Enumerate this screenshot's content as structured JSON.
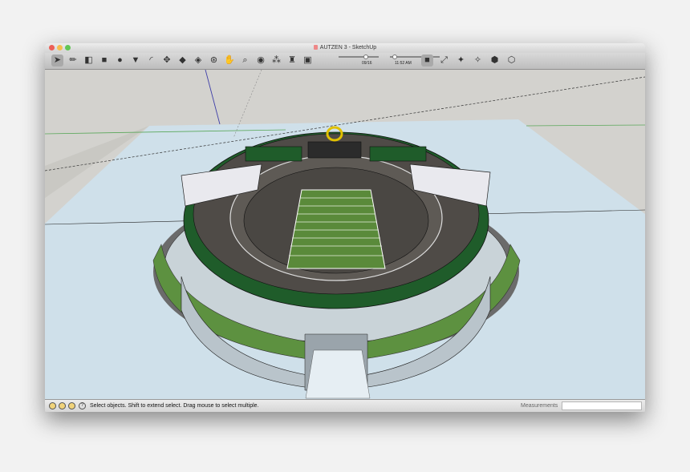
{
  "window": {
    "title": "AUTZEN 3 - SketchUp"
  },
  "toolbar": {
    "tools": [
      {
        "name": "select-tool",
        "glyph": "➤"
      },
      {
        "name": "line-tool",
        "glyph": "✏"
      },
      {
        "name": "eraser-tool",
        "glyph": "◧"
      },
      {
        "name": "rectangle-tool",
        "glyph": "■"
      },
      {
        "name": "circle-tool",
        "glyph": "●"
      },
      {
        "name": "polygon-tool",
        "glyph": "▼"
      },
      {
        "name": "arc-tool",
        "glyph": "◜"
      },
      {
        "name": "move-tool",
        "glyph": "✥"
      },
      {
        "name": "push-pull-tool",
        "glyph": "◆"
      },
      {
        "name": "paint-bucket-tool",
        "glyph": "◈"
      },
      {
        "name": "orbit-tool",
        "glyph": "⊛"
      },
      {
        "name": "pan-tool",
        "glyph": "✋"
      },
      {
        "name": "zoom-tool",
        "glyph": "⌕"
      },
      {
        "name": "look-around-tool",
        "glyph": "◉"
      },
      {
        "name": "walk-tool",
        "glyph": "⁂"
      },
      {
        "name": "position-camera-tool",
        "glyph": "♜"
      },
      {
        "name": "shadow-settings-tool",
        "glyph": "▣"
      }
    ],
    "view_tools": [
      {
        "name": "display-mode-button",
        "glyph": "■"
      },
      {
        "name": "zoom-extents-tool",
        "glyph": "⤢"
      },
      {
        "name": "components-tool",
        "glyph": "✦"
      },
      {
        "name": "outliner-tool",
        "glyph": "✧"
      },
      {
        "name": "warehouse-tool",
        "glyph": "⬢"
      },
      {
        "name": "extensions-tool",
        "glyph": "⬡"
      }
    ],
    "date_label": "09/16",
    "time_label": "11:52 AM",
    "date_value": 0.7,
    "time_value": 0.05
  },
  "status": {
    "text": "Select objects. Shift to extend select. Drag mouse to select multiple.",
    "icons": [
      "info-icon",
      "credits-icon",
      "user-icon",
      "help-icon"
    ],
    "help_glyph": "?"
  },
  "measurements": {
    "label": "Measurements",
    "value": ""
  },
  "colors": {
    "sky": "#d3d2ce",
    "ground": "#cfe0ea",
    "field": "#5a8a3a",
    "trim": "#2e6b34",
    "seats": "#504c48"
  }
}
